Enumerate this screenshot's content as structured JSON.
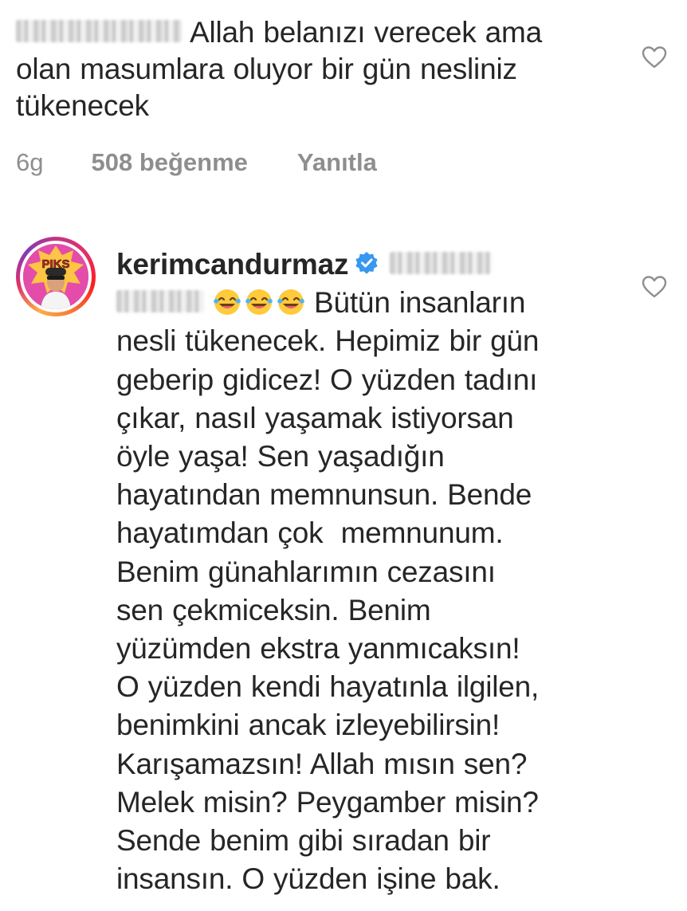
{
  "comment_1": {
    "text_line_1": "Allah belanızı verecek ama",
    "text_line_2": "olan masumlara oluyor bir gün nesliniz",
    "text_line_3": "tükenecek",
    "time": "6g",
    "likes": "508 beğenme",
    "reply_label": "Yanıtla",
    "like_icon": "heart-outline-icon"
  },
  "comment_2": {
    "username": "kerimcandurmaz",
    "verified_icon": "verified-badge-icon",
    "verified_color": "#3897f0",
    "emoji": "face-with-tears-of-joy",
    "lines": [
      "Bütün insanların",
      "nesli tükenecek. Hepimiz bir gün",
      "geberip gidicez! O yüzden tadını",
      "çıkar, nasıl yaşamak istiyorsan",
      "öyle yaşa! Sen yaşadığın",
      "hayatından memnunsun. Bende",
      "hayatımdan çok  memnunum.",
      "Benim günahlarımın cezasını",
      "sen çekmiceksin. Benim",
      "yüzümden ekstra yanmıcaksın!",
      "O yüzden kendi hayatınla ilgilen,",
      "benimkini ancak izleyebilirsin!",
      "Karışamazsın! Allah mısın sen?",
      "Melek misin? Peygamber misin?",
      "Sende benim gibi sıradan bir",
      "insansın. O yüzden işine bak."
    ],
    "like_icon": "heart-outline-icon",
    "avatar_text": "PIKS"
  }
}
